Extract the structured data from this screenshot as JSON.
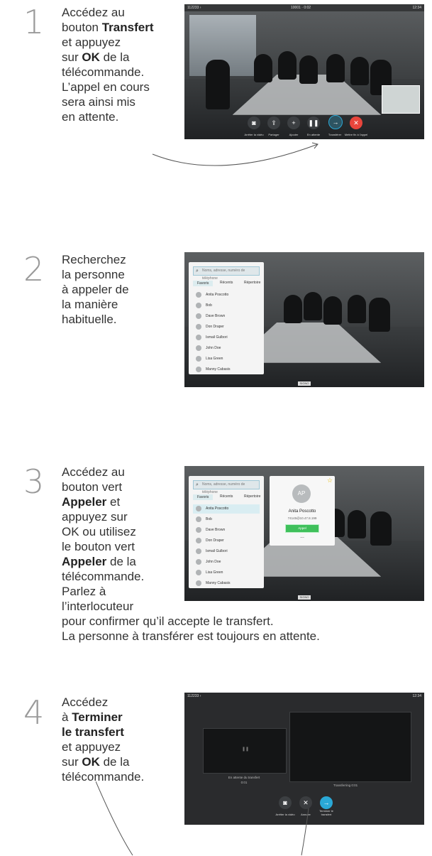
{
  "steps": [
    {
      "number": "1",
      "lines": [
        "Accédez au",
        "bouton |Transfert|",
        "et appuyez",
        "sur |OK| de la",
        "télécommande.",
        "L’appel en cours",
        "sera ainsi mis",
        "en attente."
      ]
    },
    {
      "number": "2",
      "lines": [
        "Recherchez",
        "la personne",
        "à appeler de",
        "la manière",
        "habituelle."
      ]
    },
    {
      "number": "3",
      "lines": [
        "Accédez au",
        "bouton vert",
        "|Appeler| et",
        "appuyez sur",
        "OK ou utilisez",
        "le bouton vert",
        "|Appeler| de la",
        "télécommande.",
        "Parlez à",
        "l’interlocuteur"
      ],
      "full": [
        "pour confirmer qu’il accepte le transfert.",
        "La personne à transférer est toujours en attente."
      ]
    },
    {
      "number": "4",
      "lines": [
        "Accédez",
        "à |Terminer|",
        "|le transfert|",
        "et appuyez",
        "sur |OK| de la",
        "télécommande."
      ]
    }
  ],
  "shot1": {
    "left_id": "112233 ›",
    "center": "10001 · 0:02",
    "right": "12:34",
    "controls": [
      "Arrêter la vidéo",
      "Partager",
      "Ajouter",
      "En attente",
      "Transférer",
      "Mettre fin à l'appel"
    ]
  },
  "shot2": {
    "search_placeholder": "Noms, adresse, numéro de téléphone",
    "tabs": [
      "Favoris",
      "Récents",
      "Répertoire"
    ],
    "contacts": [
      "Anita Poscotto",
      "Bob",
      "Dave Brown",
      "Don Draper",
      "Ismail Gulbori",
      "John Doe",
      "Lisa Green",
      "Manny Cabasis"
    ],
    "bottom_tag": "SIGNO"
  },
  "shot3": {
    "search_placeholder": "Noms, adresse, numéro de téléphone",
    "tabs": [
      "Favoris",
      "Récents",
      "Répertoire"
    ],
    "contacts": [
      "Anita Poscotto",
      "Bob",
      "Dave Brown",
      "Don Draper",
      "Ismail Gulbori",
      "John Doe",
      "Lisa Green",
      "Manny Cabasis"
    ],
    "card": {
      "initials": "AP",
      "name": "Anita Poscotto",
      "address": "74145@10.47.8.199",
      "call_label": "Appel",
      "more": "..."
    },
    "bottom_tag": "SIGNO"
  },
  "shot4": {
    "left_id": "112233 ›",
    "right": "12:34",
    "hold_caption": "En attente du transfert",
    "hold_sub": "0:01",
    "right_caption": "Transferring 0:01",
    "controls": [
      "Arrêter la vidéo",
      "Annuler",
      "Terminer le transfert"
    ]
  },
  "colors": {
    "accent": "#2aa8d6",
    "call_green": "#3fc05b",
    "end_red": "#e8453c"
  }
}
